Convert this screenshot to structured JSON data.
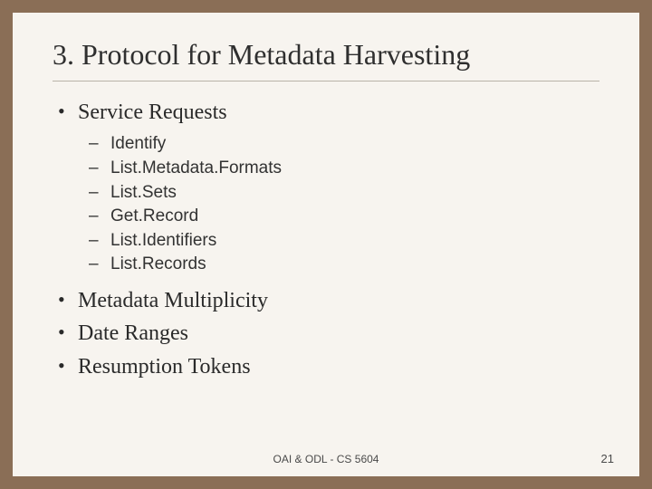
{
  "title": "3. Protocol for Metadata Harvesting",
  "bullets": {
    "b0": "Service Requests",
    "b1": "Metadata Multiplicity",
    "b2": "Date Ranges",
    "b3": "Resumption Tokens"
  },
  "sub": {
    "s0": "Identify",
    "s1": "List.Metadata.Formats",
    "s2": "List.Sets",
    "s3": "Get.Record",
    "s4": "List.Identifiers",
    "s5": "List.Records"
  },
  "footer": {
    "text": "OAI & ODL - CS 5604",
    "page": "21"
  }
}
